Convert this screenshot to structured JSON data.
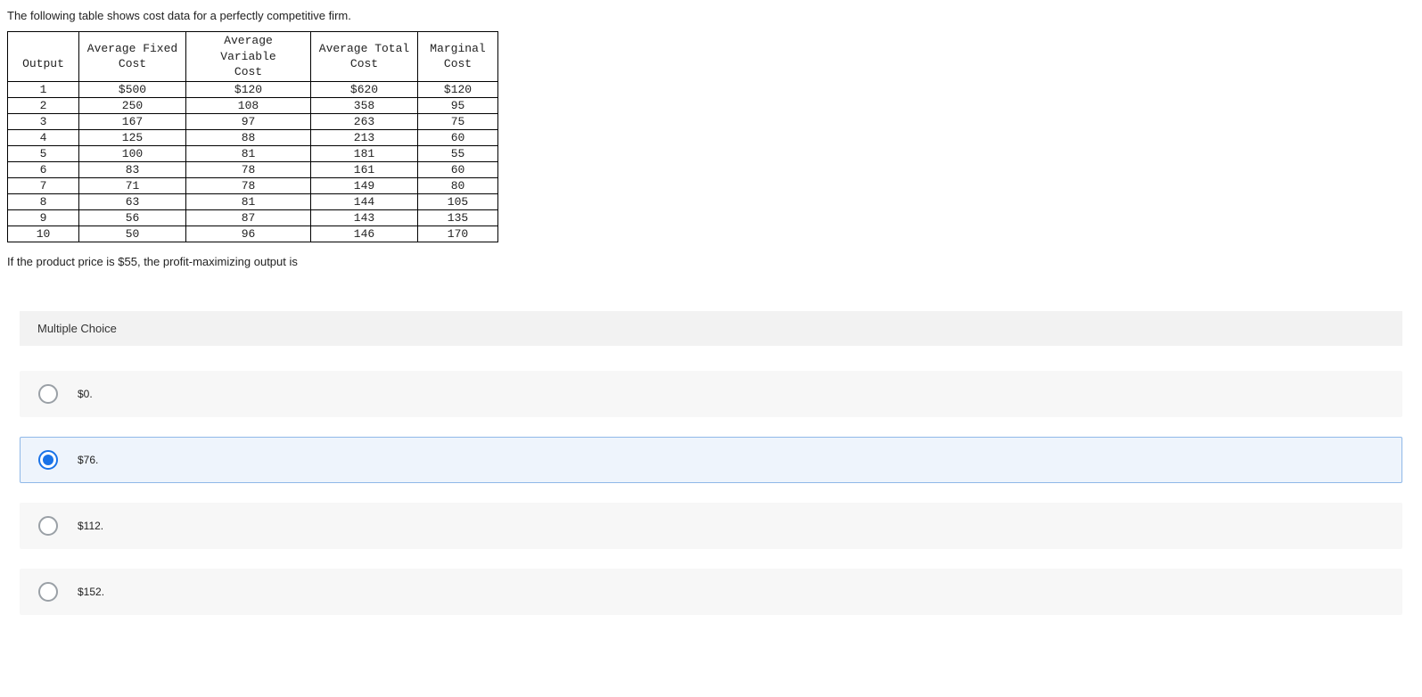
{
  "intro": "The following table shows cost data for a perfectly competitive firm.",
  "table": {
    "headers": {
      "output": "Output",
      "afc_l1": "Average Fixed",
      "afc_l2": "Cost",
      "avc_l1": "Average Variable",
      "avc_l2": "Cost",
      "atc_l1": "Average Total",
      "atc_l2": "Cost",
      "mc_l1": "Marginal",
      "mc_l2": "Cost"
    },
    "rows": [
      {
        "out": "1",
        "afc": "$500",
        "avc": "$120",
        "atc": "$620",
        "mc": "$120"
      },
      {
        "out": "2",
        "afc": "250",
        "avc": "108",
        "atc": "358",
        "mc": "95"
      },
      {
        "out": "3",
        "afc": "167",
        "avc": "97",
        "atc": "263",
        "mc": "75"
      },
      {
        "out": "4",
        "afc": "125",
        "avc": "88",
        "atc": "213",
        "mc": "60"
      },
      {
        "out": "5",
        "afc": "100",
        "avc": "81",
        "atc": "181",
        "mc": "55"
      },
      {
        "out": "6",
        "afc": "83",
        "avc": "78",
        "atc": "161",
        "mc": "60"
      },
      {
        "out": "7",
        "afc": "71",
        "avc": "78",
        "atc": "149",
        "mc": "80"
      },
      {
        "out": "8",
        "afc": "63",
        "avc": "81",
        "atc": "144",
        "mc": "105"
      },
      {
        "out": "9",
        "afc": "56",
        "avc": "87",
        "atc": "143",
        "mc": "135"
      },
      {
        "out": "10",
        "afc": "50",
        "avc": "96",
        "atc": "146",
        "mc": "170"
      }
    ]
  },
  "question": "If the product price is $55, the profit-maximizing output is",
  "mc": {
    "title": "Multiple Choice",
    "options": [
      {
        "label": "$0.",
        "selected": false
      },
      {
        "label": "$76.",
        "selected": true
      },
      {
        "label": "$112.",
        "selected": false
      },
      {
        "label": "$152.",
        "selected": false
      }
    ]
  },
  "chart_data": {
    "type": "table",
    "headers": [
      "Output",
      "Average Fixed Cost",
      "Average Variable Cost",
      "Average Total Cost",
      "Marginal Cost"
    ],
    "rows": [
      [
        1,
        500,
        120,
        620,
        120
      ],
      [
        2,
        250,
        108,
        358,
        95
      ],
      [
        3,
        167,
        97,
        263,
        75
      ],
      [
        4,
        125,
        88,
        213,
        60
      ],
      [
        5,
        100,
        81,
        181,
        55
      ],
      [
        6,
        83,
        78,
        161,
        60
      ],
      [
        7,
        71,
        78,
        149,
        80
      ],
      [
        8,
        63,
        81,
        144,
        105
      ],
      [
        9,
        56,
        87,
        143,
        135
      ],
      [
        10,
        50,
        96,
        146,
        170
      ]
    ]
  }
}
